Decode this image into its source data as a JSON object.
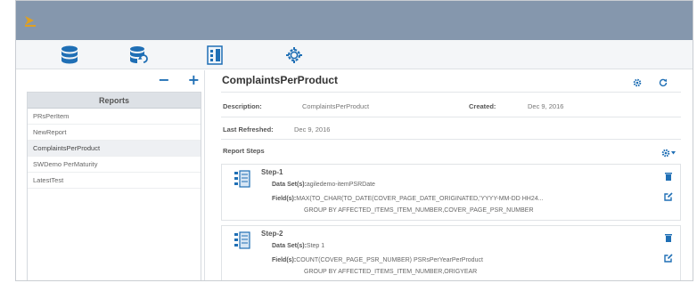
{
  "toolbar": {
    "icons": [
      "database-icon",
      "database-refresh-icon",
      "report-editor-icon",
      "settings-gear-icon"
    ]
  },
  "sidebar": {
    "minus_label": "−",
    "plus_label": "+",
    "header": "Reports",
    "items": [
      {
        "label": "PRsPerItem"
      },
      {
        "label": "NewReport"
      },
      {
        "label": "ComplaintsPerProduct",
        "selected": true
      },
      {
        "label": "SWDemo PerMaturity"
      },
      {
        "label": "LatestTest"
      }
    ]
  },
  "report": {
    "title": "ComplaintsPerProduct",
    "description_label": "Description:",
    "description_value": "ComplaintsPerProduct",
    "created_label": "Created:",
    "created_value": "Dec 9, 2016",
    "refreshed_label": "Last Refreshed:",
    "refreshed_value": "Dec 9, 2016",
    "steps_label": "Report Steps",
    "steps": [
      {
        "name": "Step-1",
        "dataset_label": "Data Set(s):",
        "dataset_value": "agiledemo-itemPSRDate",
        "fields_label": "Field(s):",
        "fields_value": "MAX(TO_CHAR(TO_DATE(COVER_PAGE_DATE_ORIGINATED,'YYYY-MM-DD HH24...",
        "group_value": "GROUP BY AFFECTED_ITEMS_ITEM_NUMBER,COVER_PAGE_PSR_NUMBER"
      },
      {
        "name": "Step-2",
        "dataset_label": "Data Set(s):",
        "dataset_value": "Step 1",
        "fields_label": "Field(s):",
        "fields_value": "COUNT(COVER_PAGE_PSR_NUMBER) PSRsPerYearPerProduct",
        "group_value": "GROUP BY AFFECTED_ITEMS_ITEM_NUMBER,ORIGYEAR"
      }
    ]
  },
  "colors": {
    "titlebar": "#8597ad",
    "accent": "#1f6fb5",
    "logo": "#e0a020"
  }
}
